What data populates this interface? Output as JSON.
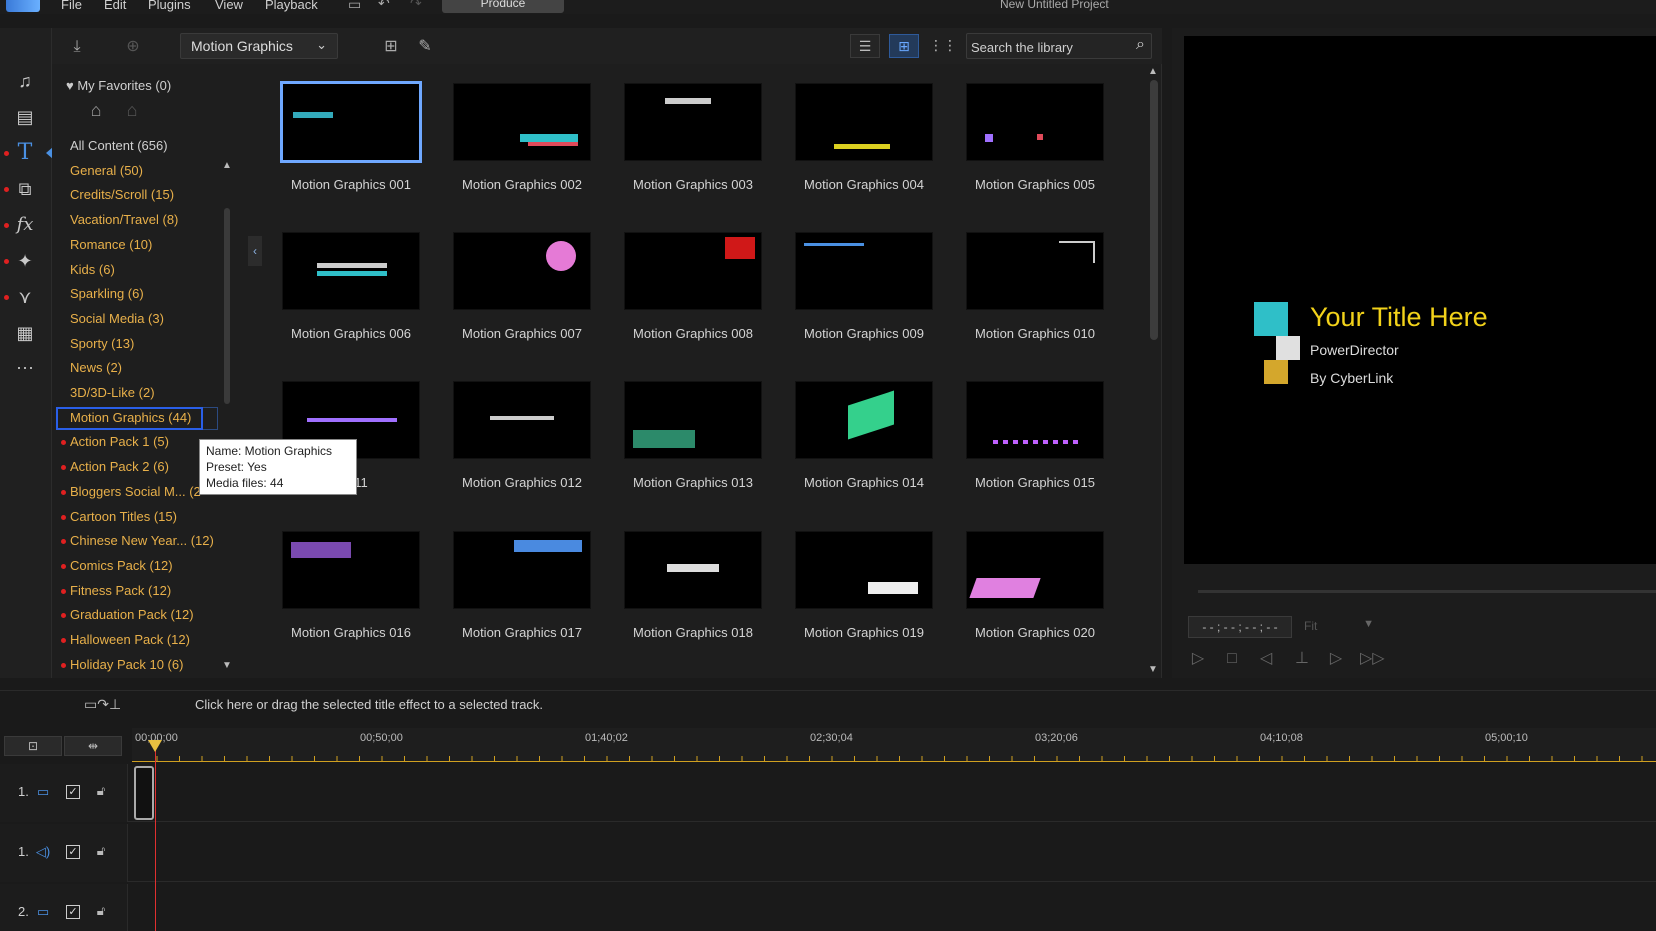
{
  "menu": [
    "File",
    "Edit",
    "Plugins",
    "View",
    "Playback"
  ],
  "produce_label": "Produce",
  "project_title": "New Untitled Project",
  "library": {
    "category_selected": "Motion Graphics",
    "search_placeholder": "Search the library",
    "favorites_label": "My Favorites (0)",
    "categories": [
      {
        "label": "All Content (656)",
        "color": "white"
      },
      {
        "label": "General  (50)"
      },
      {
        "label": "Credits/Scroll  (15)"
      },
      {
        "label": "Vacation/Travel  (8)"
      },
      {
        "label": "Romance  (10)"
      },
      {
        "label": "Kids  (6)"
      },
      {
        "label": "Sparkling  (6)"
      },
      {
        "label": "Social Media  (3)"
      },
      {
        "label": "Sporty  (13)"
      },
      {
        "label": "News  (2)"
      },
      {
        "label": "3D/3D-Like  (2)"
      },
      {
        "label": "Motion Graphics  (44)",
        "selected": true
      },
      {
        "label": "Action Pack 1  (5)",
        "dot": true
      },
      {
        "label": "Action Pack 2  (6)",
        "dot": true
      },
      {
        "label": "Bloggers Social M...  (2",
        "dot": true
      },
      {
        "label": "Cartoon Titles  (15)",
        "dot": true
      },
      {
        "label": "Chinese New Year...  (12)",
        "dot": true
      },
      {
        "label": "Comics Pack  (12)",
        "dot": true
      },
      {
        "label": "Fitness Pack  (12)",
        "dot": true
      },
      {
        "label": "Graduation Pack  (12)",
        "dot": true
      },
      {
        "label": "Halloween Pack  (12)",
        "dot": true
      },
      {
        "label": "Holiday Pack 10  (6)",
        "dot": true
      }
    ],
    "items": [
      "Motion Graphics 001",
      "Motion Graphics 002",
      "Motion Graphics 003",
      "Motion Graphics 004",
      "Motion Graphics 005",
      "Motion Graphics 006",
      "Motion Graphics 007",
      "Motion Graphics 008",
      "Motion Graphics 009",
      "Motion Graphics 010",
      "phics 011",
      "Motion Graphics 012",
      "Motion Graphics 013",
      "Motion Graphics 014",
      "Motion Graphics 015",
      "Motion Graphics 016",
      "Motion Graphics 017",
      "Motion Graphics 018",
      "Motion Graphics 019",
      "Motion Graphics 020"
    ],
    "tooltip": {
      "name": "Name: Motion Graphics",
      "preset": "Preset: Yes",
      "media": "Media files: 44"
    }
  },
  "preview": {
    "title": "Your Title Here",
    "sub1": "PowerDirector",
    "sub2": "By CyberLink",
    "timecode": "- - ; - - ; - - ; - -",
    "fit": "Fit"
  },
  "timeline": {
    "hint": "Click here or drag the selected title effect to a selected track.",
    "ruler": [
      "00;00;00",
      "00;50;00",
      "01;40;02",
      "02;30;04",
      "03;20;06",
      "04;10;08",
      "05;00;10"
    ],
    "tracks": [
      "1.",
      "1.",
      "2."
    ]
  },
  "colors": {
    "accent": "#4a90e2",
    "category": "#e8b04a",
    "preview_title": "#f2d21a",
    "playhead": "#e03030"
  }
}
